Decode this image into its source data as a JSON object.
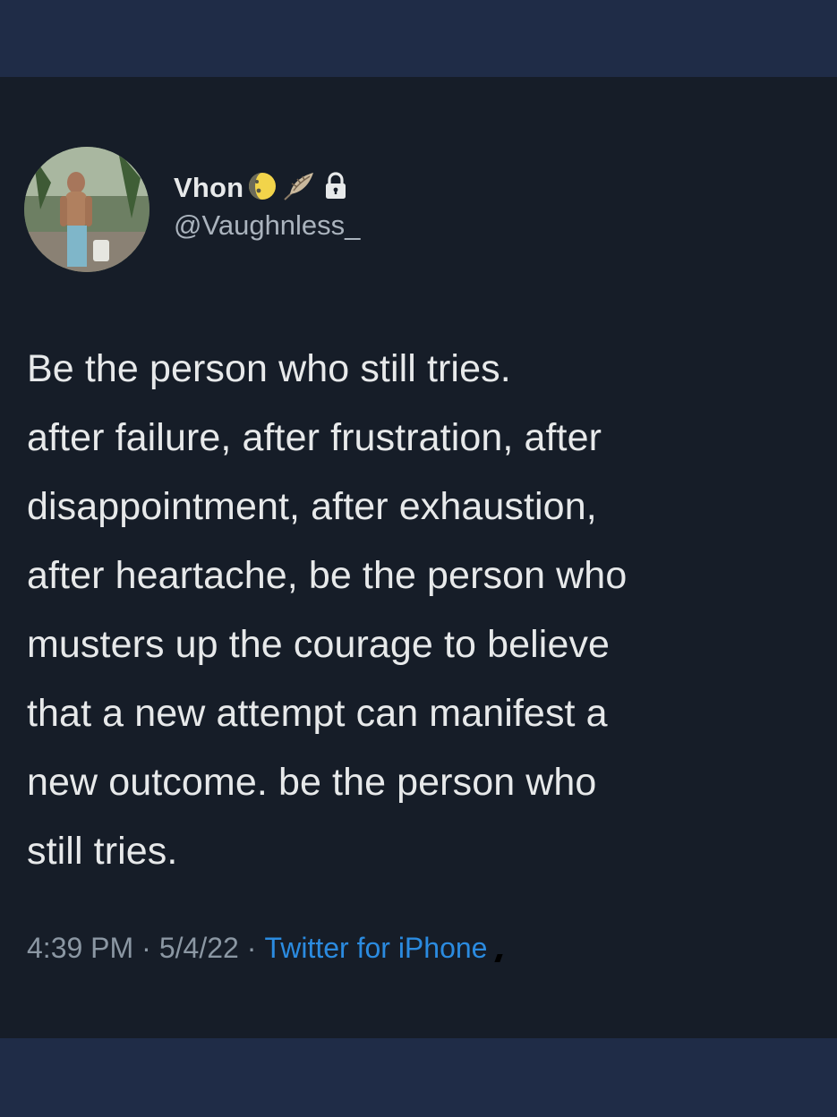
{
  "author": {
    "display_name": "Vhon",
    "handle": "@Vaughnless_",
    "badges": [
      "moon-emoji-icon",
      "feather-emoji-icon",
      "lock-icon"
    ]
  },
  "tweet": {
    "text": "Be the person who still tries.\nafter failure, after frustration, after\ndisappointment, after exhaustion,\nafter heartache, be the person who\nmusters up the courage to believe\nthat a new attempt can manifest a\nnew outcome. be the person who\nstill tries.",
    "time": "4:39 PM",
    "date": "5/4/22",
    "separator": "·",
    "source": "Twitter for iPhone"
  },
  "colors": {
    "background": "#161d28",
    "band": "#1f2c47",
    "text": "#e7e9ea",
    "muted": "#8b97a3",
    "link": "#2b8be0"
  }
}
